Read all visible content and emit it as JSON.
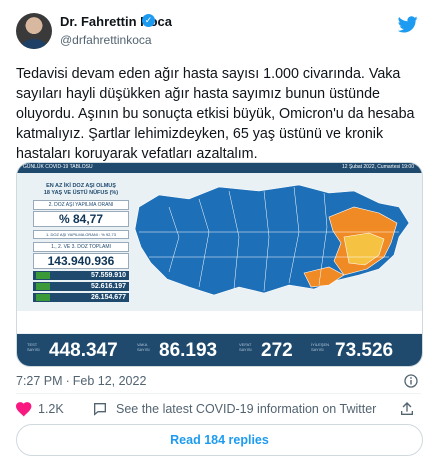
{
  "author": {
    "name": "Dr. Fahrettin Koca",
    "handle": "@drfahrettinkoca"
  },
  "tweet": {
    "text": "Tedavisi devam eden ağır hasta sayısı 1.000 civarında. Vaka sayıları hayli düşükken ağır hasta sayımız bunun üstünde oluyordu. Aşının bu sonuçta etkisi büyük, Omicron'u da hesaba katmalıyız. Şartlar lehimizdeyken, 65 yaş üstünü ve kronik hastaları koruyarak vefatları azaltalım.",
    "time": "7:27 PM",
    "date": "Feb 12, 2022",
    "separator": "·"
  },
  "card": {
    "header_left": "GÜNLÜK COVID-19 TABLOSU",
    "header_right": "12 Şubat 2022, Cumartesi 19:00",
    "panel_title_1": "EN AZ İKİ DOZ AŞI OLMUŞ",
    "panel_title_2": "18 YAŞ VE ÜSTÜ NÜFUS (%)",
    "dose2_label": "2. DOZ AŞI YAPILMA ORANI",
    "dose2_value": "% 84,77",
    "dose1_note": "1. DOZ AŞI YAPILMA ORANI : % 92,73",
    "total_label": "1., 2. VE 3. DOZ TOPLAMI",
    "total_value": "143.940.936",
    "dose_rows": [
      "57.559.910",
      "52.616.197",
      "26.154.677"
    ],
    "bottom_labels": [
      "TEST SAYISI",
      "VAKA SAYISI",
      "VEFAT SAYISI",
      "İYİLEŞEN SAYISI"
    ],
    "bottom_values": [
      "448.347",
      "86.193",
      "272",
      "73.526"
    ]
  },
  "actions": {
    "likes": "1.2K",
    "info_text": "See the latest COVID-19 information on Twitter",
    "read_replies": "Read 184 replies"
  },
  "colors": {
    "accent": "#1d9bf0",
    "map_blue": "#1d6fb8",
    "map_orange": "#f08a24",
    "map_yellow": "#f5c242",
    "card_dark": "#1f4a6e"
  },
  "icons": [
    "twitter-bird-icon",
    "verified-badge-icon",
    "heart-icon",
    "reply-icon",
    "info-icon",
    "share-icon"
  ]
}
